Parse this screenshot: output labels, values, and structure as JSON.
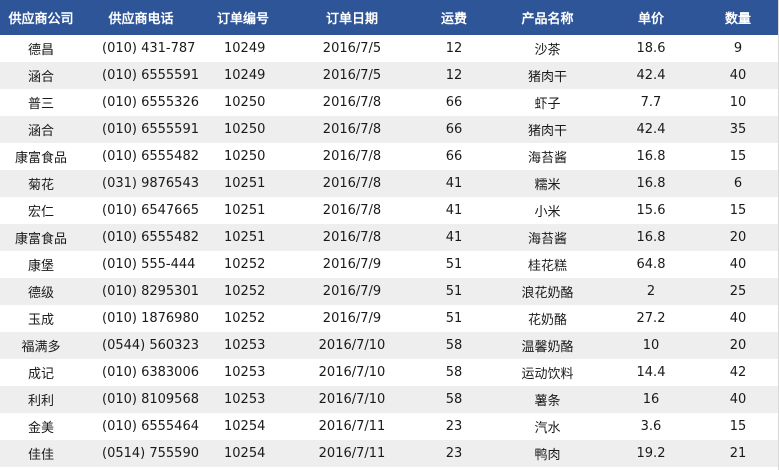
{
  "table": {
    "headers": [
      "供应商公司",
      "供应商电话",
      "订单编号",
      "订单日期",
      "运费",
      "产品名称",
      "单价",
      "数量"
    ],
    "rows": [
      [
        "德昌",
        "(010) 431-787",
        "10249",
        "2016/7/5",
        "12",
        "沙茶",
        "18.6",
        "9"
      ],
      [
        "涵合",
        "(010) 6555591",
        "10249",
        "2016/7/5",
        "12",
        "猪肉干",
        "42.4",
        "40"
      ],
      [
        "普三",
        "(010) 6555326",
        "10250",
        "2016/7/8",
        "66",
        "虾子",
        "7.7",
        "10"
      ],
      [
        "涵合",
        "(010) 6555591",
        "10250",
        "2016/7/8",
        "66",
        "猪肉干",
        "42.4",
        "35"
      ],
      [
        "康富食品",
        "(010) 6555482",
        "10250",
        "2016/7/8",
        "66",
        "海苔酱",
        "16.8",
        "15"
      ],
      [
        "菊花",
        "(031) 9876543",
        "10251",
        "2016/7/8",
        "41",
        "糯米",
        "16.8",
        "6"
      ],
      [
        "宏仁",
        "(010) 6547665",
        "10251",
        "2016/7/8",
        "41",
        "小米",
        "15.6",
        "15"
      ],
      [
        "康富食品",
        "(010) 6555482",
        "10251",
        "2016/7/8",
        "41",
        "海苔酱",
        "16.8",
        "20"
      ],
      [
        "康堡",
        "(010) 555-444",
        "10252",
        "2016/7/9",
        "51",
        "桂花糕",
        "64.8",
        "40"
      ],
      [
        "德级",
        "(010) 8295301",
        "10252",
        "2016/7/9",
        "51",
        "浪花奶酪",
        "2",
        "25"
      ],
      [
        "玉成",
        "(010) 1876980",
        "10252",
        "2016/7/9",
        "51",
        "花奶酪",
        "27.2",
        "40"
      ],
      [
        "福满多",
        "(0544) 560323",
        "10253",
        "2016/7/10",
        "58",
        "温馨奶酪",
        "10",
        "20"
      ],
      [
        "成记",
        "(010) 6383006",
        "10253",
        "2016/7/10",
        "58",
        "运动饮料",
        "14.4",
        "42"
      ],
      [
        "利利",
        "(010) 8109568",
        "10253",
        "2016/7/10",
        "58",
        "薯条",
        "16",
        "40"
      ],
      [
        "金美",
        "(010) 6555464",
        "10254",
        "2016/7/11",
        "23",
        "汽水",
        "3.6",
        "15"
      ],
      [
        "佳佳",
        "(0514) 755590",
        "10254",
        "2016/7/11",
        "23",
        "鸭肉",
        "19.2",
        "21"
      ]
    ]
  },
  "colors": {
    "header_bg": "#2e5597",
    "header_text": "#ffffff",
    "stripe": "#eeeeee"
  }
}
